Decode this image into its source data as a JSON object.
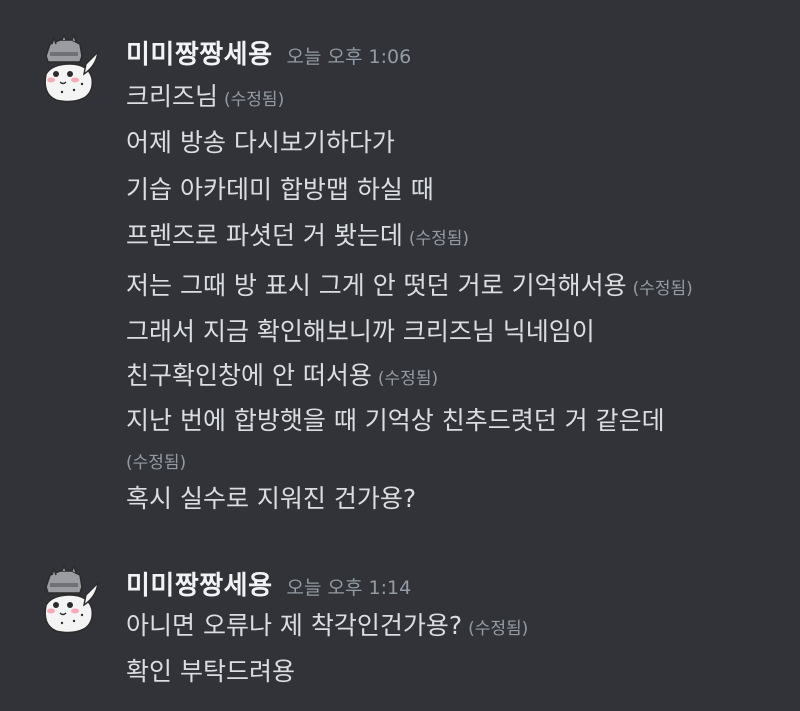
{
  "colors": {
    "background": "#313338",
    "username": "#f2f3f5",
    "text": "#dbdee1",
    "muted": "#949ba4"
  },
  "groups": [
    {
      "avatar_icon": "dragon-knight-avatar-icon",
      "username": "미미짱짱세용",
      "timestamp": "오늘 오후 1:06",
      "lines": [
        {
          "text": "크리즈님",
          "edited": "(수정됨)"
        },
        {
          "text": "어제 방송 다시보기하다가"
        },
        {
          "text": "기습 아카데미 합방맵 하실 때"
        },
        {
          "text": "프렌즈로 파셧던 거 봣는데",
          "edited": "(수정됨)"
        },
        {
          "text": "저는 그때 방 표시 그게 안 떳던 거로 기억해서용",
          "edited": "(수정됨)"
        },
        {
          "text": "그래서 지금 확인해보니까 크리즈님 닉네임이"
        },
        {
          "text": "친구확인창에 안 떠서용",
          "edited": "(수정됨)"
        },
        {
          "text": "지난 번에 합방햇을 때 기억상 친추드렷던 거 같은데"
        },
        {
          "text": "",
          "edited": "(수정됨)"
        },
        {
          "text": "혹시 실수로 지워진 건가용?"
        }
      ]
    },
    {
      "avatar_icon": "dragon-knight-avatar-icon",
      "username": "미미짱짱세용",
      "timestamp": "오늘 오후 1:14",
      "lines": [
        {
          "text": "아니면 오류나 제 착각인건가용?",
          "edited": "(수정됨)"
        },
        {
          "text": "확인 부탁드려용"
        }
      ]
    }
  ]
}
